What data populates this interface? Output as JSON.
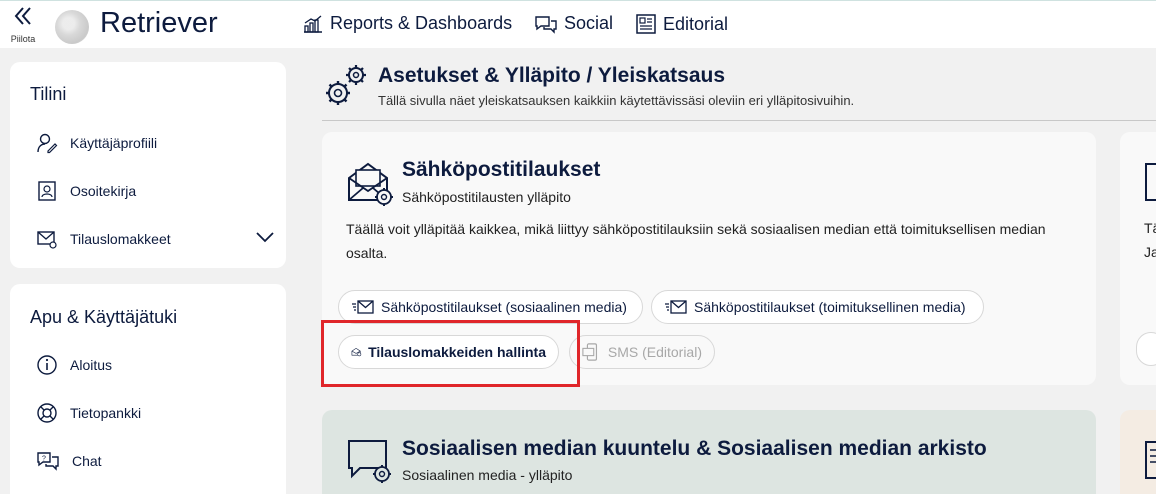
{
  "topbar": {
    "collapse_label": "Piilota",
    "logo_text": "Retriever",
    "nav": [
      {
        "label": "Reports & Dashboards"
      },
      {
        "label": "Social"
      },
      {
        "label": "Editorial"
      }
    ]
  },
  "sidebar": {
    "account": {
      "heading": "Tilini",
      "items": [
        {
          "label": "Käyttäjäprofiili"
        },
        {
          "label": "Osoitekirja"
        },
        {
          "label": "Tilauslomakkeet"
        }
      ]
    },
    "help": {
      "heading": "Apu & Käyttäjätuki",
      "items": [
        {
          "label": "Aloitus"
        },
        {
          "label": "Tietopankki"
        },
        {
          "label": "Chat"
        }
      ]
    }
  },
  "page": {
    "title": "Asetukset & Ylläpito / Yleiskatsaus",
    "subtitle": "Tällä sivulla näet yleiskatsauksen kaikkiin käytettävissäsi oleviin eri ylläpitosivuihin."
  },
  "cards": {
    "email": {
      "title": "Sähköpostitilaukset",
      "subtitle": "Sähköpostitilausten ylläpito",
      "description_line1": "Täällä voit ylläpitää kaikkea, mikä liittyy sähköpostitilauksiin sekä sosiaalisen median että toimituksellisen median",
      "description_line2": "osalta.",
      "buttons": [
        {
          "label": "Sähköpostitilaukset (sosiaalinen media)"
        },
        {
          "label": "Sähköpostitilaukset (toimituksellinen media)"
        },
        {
          "label": "Tilauslomakkeiden hallinta"
        },
        {
          "label": "SMS (Editorial)"
        }
      ]
    },
    "social": {
      "title": "Sosiaalisen median kuuntelu & Sosiaalisen median arkisto",
      "subtitle": "Sosiaalinen media - ylläpito"
    },
    "right_partial": {
      "text": "Tä",
      "text2": "Ja"
    }
  },
  "colors": {
    "navy": "#0d1b3e",
    "highlight": "#e0262a",
    "social_card_bg": "#dde5e1",
    "right_card_bg": "#f4ece3"
  }
}
